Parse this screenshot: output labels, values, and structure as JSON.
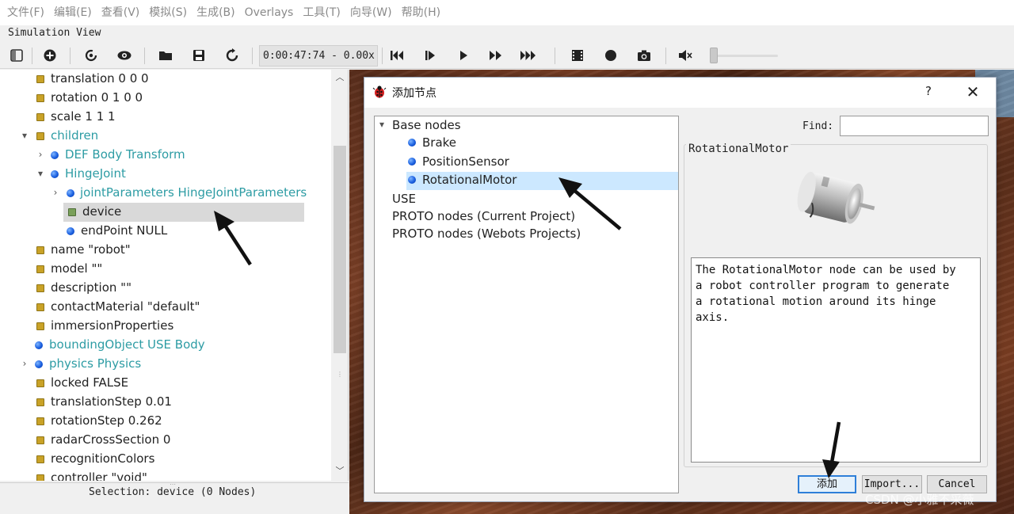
{
  "menubar": {
    "items": [
      "文件(F)",
      "编辑(E)",
      "查看(V)",
      "模拟(S)",
      "生成(B)",
      "Overlays",
      "工具(T)",
      "向导(W)",
      "帮助(H)"
    ]
  },
  "simulation_view": {
    "title": "Simulation View"
  },
  "toolbar": {
    "time": "0:00:47:74 -  0.00x",
    "icons": [
      "toggle-panel-icon",
      "add-node-icon",
      "reload-icon",
      "view-icon",
      "open-folder-icon",
      "save-icon",
      "reset-icon",
      "step-back-icon",
      "step-icon",
      "play-icon",
      "fast-forward-icon",
      "fastest-icon",
      "record-movie-icon",
      "record-icon",
      "screenshot-icon",
      "mute-icon"
    ],
    "speed_level": 0
  },
  "scene_tree": {
    "rows": [
      {
        "label": "translation 0 0 0"
      },
      {
        "label": "rotation 0 1 0 0"
      },
      {
        "label": "scale 1 1 1"
      },
      {
        "label": "children"
      },
      {
        "label": "DEF Body Transform"
      },
      {
        "label": "HingeJoint"
      },
      {
        "label": "jointParameters HingeJointParameters"
      },
      {
        "label": "device"
      },
      {
        "label": "endPoint NULL"
      },
      {
        "label": "name \"robot\""
      },
      {
        "label": "model \"\""
      },
      {
        "label": "description \"\""
      },
      {
        "label": "contactMaterial \"default\""
      },
      {
        "label": "immersionProperties"
      },
      {
        "label": "boundingObject USE Body"
      },
      {
        "label": "physics Physics"
      },
      {
        "label": "locked FALSE"
      },
      {
        "label": "translationStep 0.01"
      },
      {
        "label": "rotationStep 0.262"
      },
      {
        "label": "radarCrossSection 0"
      },
      {
        "label": "recognitionColors"
      },
      {
        "label": "controller \"void\""
      }
    ],
    "status": "Selection: device (0 Nodes)"
  },
  "dialog": {
    "title": "添加节点",
    "help": "?",
    "close": "✕",
    "tree": {
      "base_nodes": "Base nodes",
      "children": [
        "Brake",
        "PositionSensor",
        "RotationalMotor"
      ],
      "use": "USE",
      "proto_current": "PROTO nodes (Current Project)",
      "proto_webots": "PROTO nodes (Webots Projects)"
    },
    "find_label": "Find:",
    "find_value": "",
    "info_title": "RotationalMotor",
    "description_lines": [
      "The RotationalMotor node can be used by",
      "a robot controller program to generate",
      "a rotational motion around its hinge",
      "axis."
    ],
    "buttons": {
      "add": "添加",
      "import": "Import...",
      "cancel": "Cancel"
    }
  },
  "watermark": "CSDN @小雅不采薇"
}
